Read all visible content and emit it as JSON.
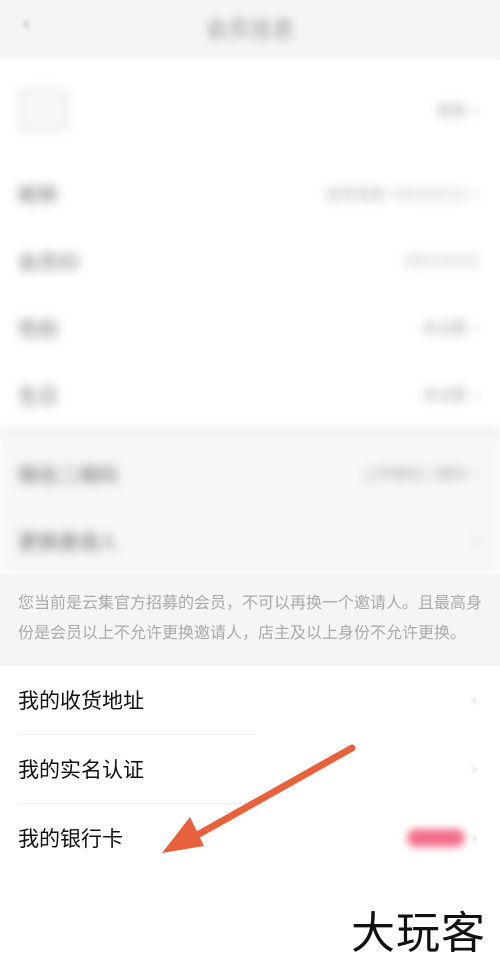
{
  "header": {
    "back_icon": "chevron-left-icon",
    "title": "会员信息"
  },
  "profile": {
    "avatar_label": "",
    "avatar_value": "更换",
    "rows": [
      {
        "label": "昵称",
        "value": "会员信息 15111111"
      },
      {
        "label": "会员ID",
        "value": "15111111"
      },
      {
        "label": "性别",
        "value": "未设置"
      },
      {
        "label": "生日",
        "value": "未设置"
      }
    ]
  },
  "account": {
    "rows": [
      {
        "label": "微信二维码",
        "value": "上传微信二维码"
      },
      {
        "label": "更换邀请人",
        "value": ""
      }
    ],
    "notice": "您当前是云集官方招募的会员，不可以再换一个邀请人。且最高身份是会员以上不允许更换邀请人，店主及以上身份不允许更换。"
  },
  "menu": {
    "items": [
      {
        "label": "我的收货地址"
      },
      {
        "label": "我的实名认证"
      },
      {
        "label": "我的银行卡"
      }
    ]
  },
  "watermark": "大玩客",
  "colors": {
    "arrow": "#e8613c",
    "badge": "#f26f8a"
  }
}
